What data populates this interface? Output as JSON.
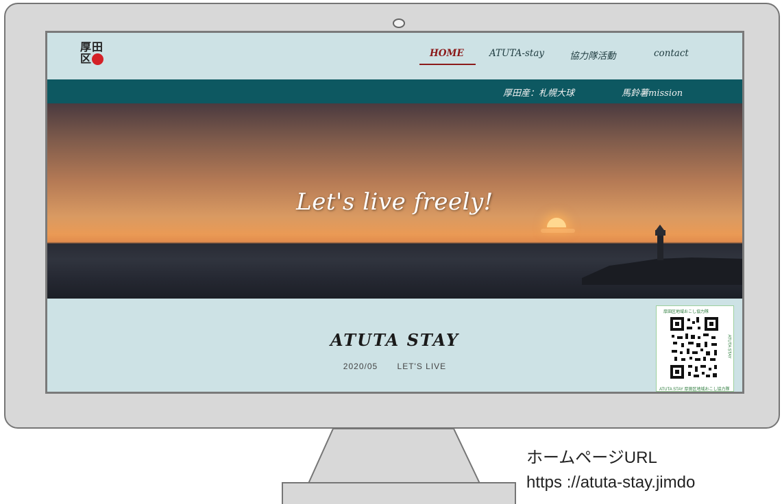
{
  "site": {
    "logo": {
      "char1": "厚",
      "char2": "田",
      "char3": "区"
    },
    "nav": [
      {
        "label": "HOME",
        "active": true
      },
      {
        "label": "ATUTA-stay",
        "active": false
      },
      {
        "label": "協力隊活動",
        "active": false
      },
      {
        "label": "contact",
        "active": false
      }
    ],
    "subnav": [
      {
        "label": "厚田産：札幌大球"
      },
      {
        "label": "馬鈴薯mission"
      }
    ],
    "hero": {
      "title": "Let's live freely!"
    },
    "section": {
      "title": "ATUTA STAY",
      "date": "2020/05",
      "tagline": "LET'S LIVE"
    },
    "qr": {
      "top_text": "厚田区地域おこし協力隊",
      "side_text": "ATUTA STAY",
      "bottom_text": "ATUTA STAY 厚田区地域おこし協力隊"
    }
  },
  "caption": {
    "line1": "ホームページURL",
    "line2": "https ://atuta-stay.jimdo"
  },
  "colors": {
    "header_bg": "#cde2e5",
    "subnav_bg": "#0d5861",
    "active_nav": "#8b1a1a",
    "logo_dot": "#d42127",
    "monitor_body": "#d8d8d8"
  }
}
